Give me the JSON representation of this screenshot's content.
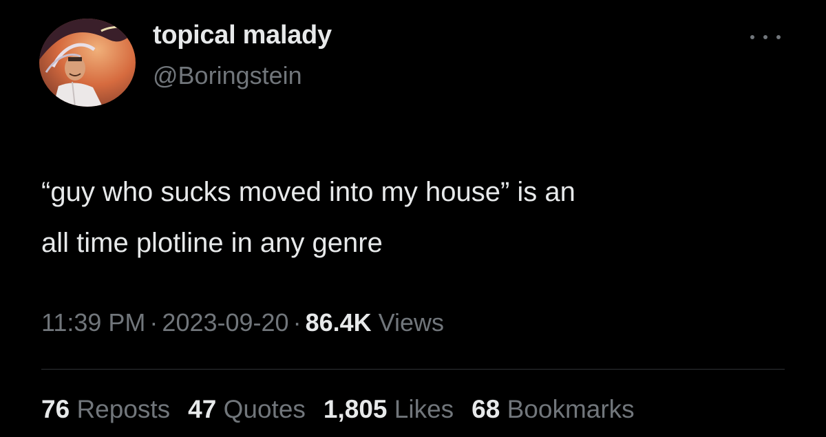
{
  "author": {
    "display_name": "topical malady",
    "handle": "@Boringstein",
    "avatar_icon": "profile-photo"
  },
  "more_icon": "ellipsis-icon",
  "tweet": {
    "text": "“guy who sucks moved into my house” is an\nall time plotline in any genre"
  },
  "meta": {
    "time": "11:39 PM",
    "separator": "·",
    "date": "2023-09-20",
    "views_count": "86.4K",
    "views_label": "Views"
  },
  "stats": [
    {
      "count": "76",
      "label": "Reposts"
    },
    {
      "count": "47",
      "label": "Quotes"
    },
    {
      "count": "1,805",
      "label": "Likes"
    },
    {
      "count": "68",
      "label": "Bookmarks"
    }
  ],
  "colors": {
    "background": "#000000",
    "primary_text": "#e7e9ea",
    "secondary_text": "#71767b",
    "divider": "#2f3336"
  }
}
